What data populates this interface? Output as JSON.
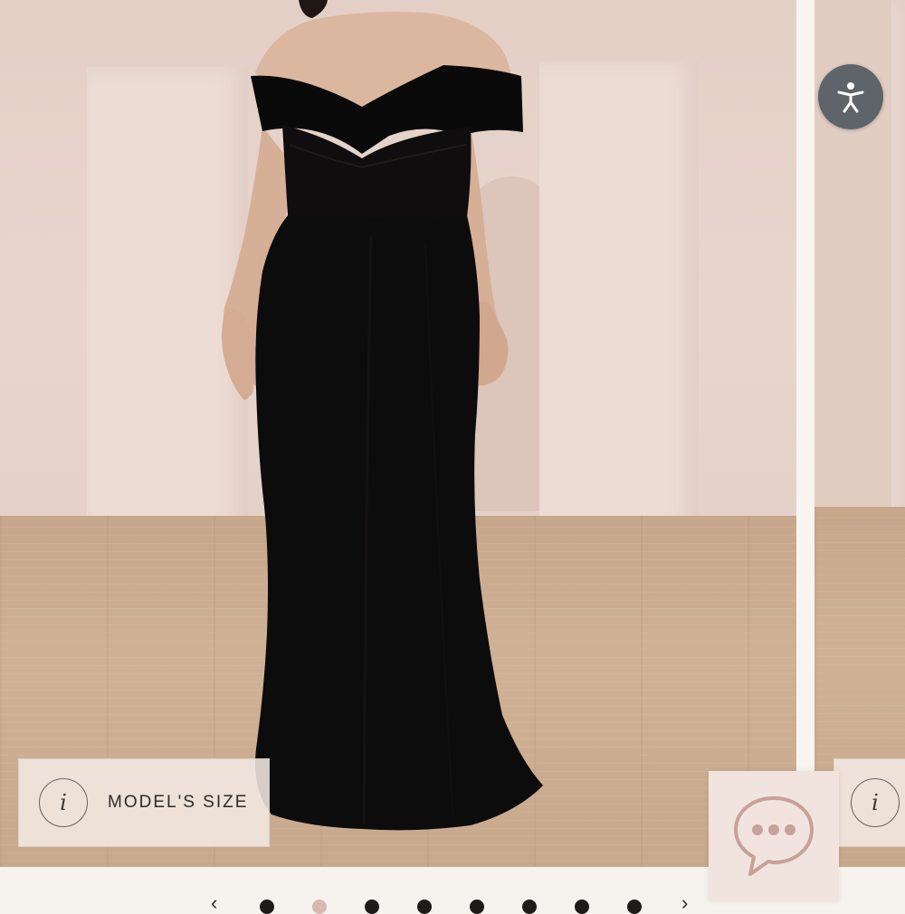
{
  "gallery": {
    "model_size_label": "MODEL'S SIZE",
    "info_glyph": "i",
    "dot_count": 8,
    "active_dot": 1
  },
  "icons": {
    "accessibility": "accessibility-icon",
    "chat": "chat-icon",
    "info": "info-icon",
    "prev": "chevron-left-icon",
    "next": "chevron-right-icon"
  },
  "colors": {
    "accessibility_bg": "#5e6469",
    "chat_bg": "#f1e4df",
    "chat_stroke": "#c7a19a",
    "dot": "#1f1b19",
    "dot_active": "#d8b9b2",
    "dress": "#0d0c0c"
  },
  "pager": {
    "prev_glyph": "‹",
    "next_glyph": "›"
  }
}
